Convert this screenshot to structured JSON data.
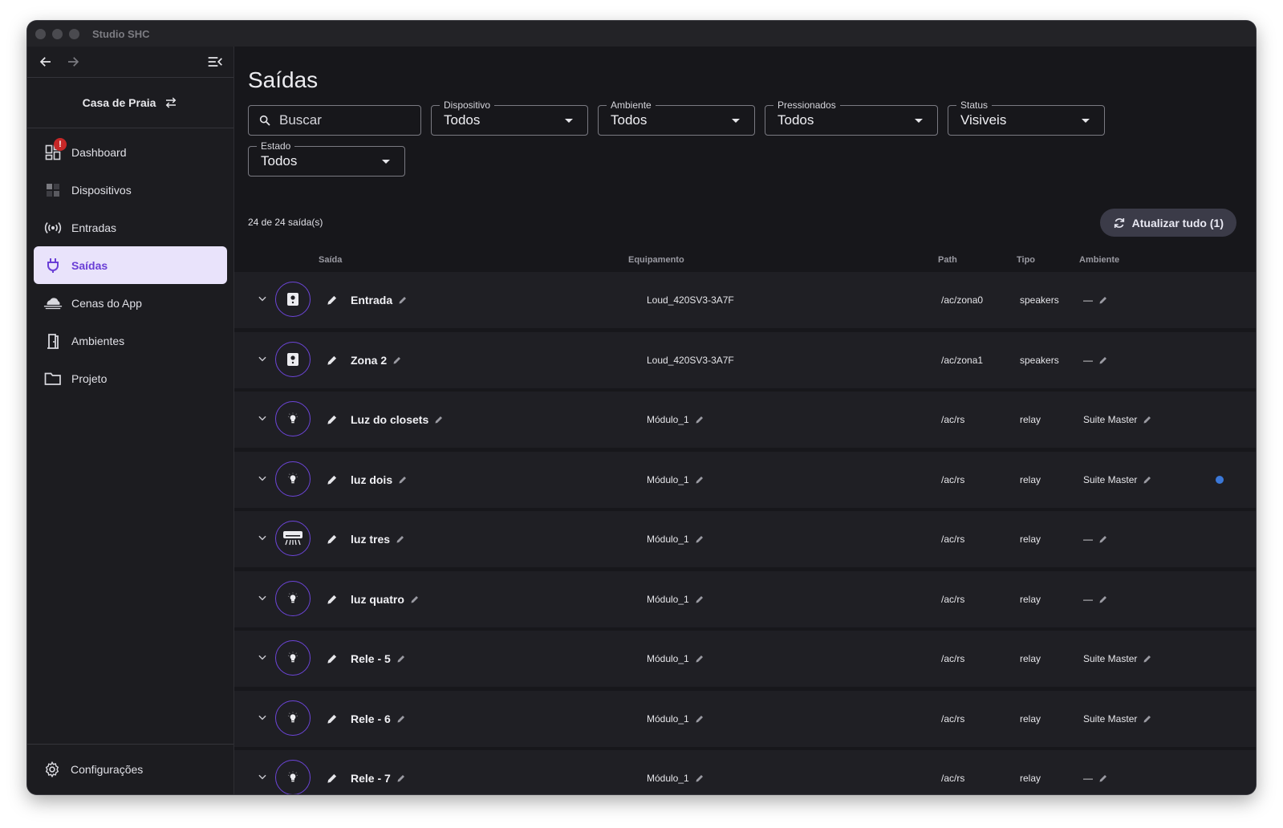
{
  "window": {
    "title": "Studio SHC"
  },
  "sidebar": {
    "project": "Casa de Praia",
    "items": [
      {
        "label": "Dashboard",
        "icon": "dashboard-icon",
        "badge": "!"
      },
      {
        "label": "Dispositivos",
        "icon": "devices-icon"
      },
      {
        "label": "Entradas",
        "icon": "broadcast-icon"
      },
      {
        "label": "Saídas",
        "icon": "plug-icon",
        "active": true
      },
      {
        "label": "Cenas do App",
        "icon": "cloud-icon"
      },
      {
        "label": "Ambientes",
        "icon": "door-icon"
      },
      {
        "label": "Projeto",
        "icon": "folder-icon"
      }
    ],
    "settings": "Configurações"
  },
  "main": {
    "title": "Saídas",
    "search": {
      "placeholder": "Buscar"
    },
    "filters": [
      {
        "label": "Dispositivo",
        "value": "Todos"
      },
      {
        "label": "Ambiente",
        "value": "Todos"
      },
      {
        "label": "Pressionados",
        "value": "Todos"
      },
      {
        "label": "Status",
        "value": "Visiveis"
      },
      {
        "label": "Estado",
        "value": "Todos"
      }
    ],
    "count": "24 de 24 saída(s)",
    "refresh_label": "Atualizar tudo (1)",
    "columns": {
      "saida": "Saída",
      "equipamento": "Equipamento",
      "path": "Path",
      "tipo": "Tipo",
      "ambiente": "Ambiente"
    },
    "rows": [
      {
        "name": "Entrada",
        "icon": "speaker-icon",
        "equip": "Loud_420SV3-3A7F",
        "path": "/ac/zona0",
        "tipo": "speakers",
        "amb": "—"
      },
      {
        "name": "Zona 2",
        "icon": "speaker-icon",
        "equip": "Loud_420SV3-3A7F",
        "path": "/ac/zona1",
        "tipo": "speakers",
        "amb": "—"
      },
      {
        "name": "Luz do closets",
        "icon": "lightbulb-icon",
        "equip": "Módulo_1",
        "path": "/ac/rs",
        "tipo": "relay",
        "amb": "Suite Master"
      },
      {
        "name": "luz dois",
        "icon": "lightbulb-icon",
        "equip": "Módulo_1",
        "path": "/ac/rs",
        "tipo": "relay",
        "amb": "Suite Master",
        "dot": true
      },
      {
        "name": "luz tres",
        "icon": "air-conditioner-icon",
        "equip": "Módulo_1",
        "path": "/ac/rs",
        "tipo": "relay",
        "amb": "—"
      },
      {
        "name": "luz quatro",
        "icon": "lightbulb-icon",
        "equip": "Módulo_1",
        "path": "/ac/rs",
        "tipo": "relay",
        "amb": "—"
      },
      {
        "name": "Rele - 5",
        "icon": "lightbulb-icon",
        "equip": "Módulo_1",
        "path": "/ac/rs",
        "tipo": "relay",
        "amb": "Suite Master"
      },
      {
        "name": "Rele - 6",
        "icon": "lightbulb-icon",
        "equip": "Módulo_1",
        "path": "/ac/rs",
        "tipo": "relay",
        "amb": "Suite Master"
      },
      {
        "name": "Rele - 7",
        "icon": "lightbulb-icon",
        "equip": "Módulo_1",
        "path": "/ac/rs",
        "tipo": "relay",
        "amb": "—"
      }
    ]
  }
}
